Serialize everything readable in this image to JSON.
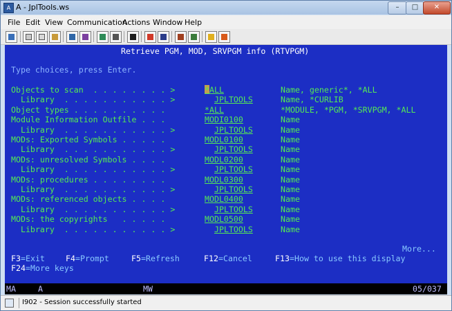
{
  "window": {
    "title": "A - JplTools.ws",
    "app_icon_label": "A"
  },
  "menu": [
    {
      "label": "File"
    },
    {
      "label": "Edit"
    },
    {
      "label": "View"
    },
    {
      "label": "Communication"
    },
    {
      "label": "Actions"
    },
    {
      "label": "Window"
    },
    {
      "label": "Help"
    }
  ],
  "screen": {
    "title": "Retrieve PGM, MOD, SRVPGM info (RTVPGM)",
    "instruction": "Type choices, press Enter.",
    "rows": [
      {
        "label": "Objects to scan  . . . . . . . . >",
        "value": "*ALL",
        "help": "Name, generic*, *ALL"
      },
      {
        "label": "  Library  . . . . . . . . . . . >",
        "value": "JPLTOOLS",
        "help": "Name, *CURLIB"
      },
      {
        "label": "Object types . . . . . . . . . . ",
        "value": "*ALL",
        "help": "*MODULE, *PGM, *SRVPGM, *ALL"
      },
      {
        "label": "Module Information Outfile . . . ",
        "value": "MODI0100",
        "help": "Name"
      },
      {
        "label": "  Library  . . . . . . . . . . . >",
        "value": "JPLTOOLS",
        "help": "Name"
      },
      {
        "label": "MODs: Exported Symbols . . . . . ",
        "value": "MODL0100",
        "help": "Name"
      },
      {
        "label": "  Library  . . . . . . . . . . . >",
        "value": "JPLTOOLS",
        "help": "Name"
      },
      {
        "label": "MODs: unresolved Symbols . . . . ",
        "value": "MODL0200",
        "help": "Name"
      },
      {
        "label": "  Library  . . . . . . . . . . . >",
        "value": "JPLTOOLS",
        "help": "Name"
      },
      {
        "label": "MODs: procedures . . . . . . . . ",
        "value": "MODL0300",
        "help": "Name"
      },
      {
        "label": "  Library  . . . . . . . . . . . >",
        "value": "JPLTOOLS",
        "help": "Name"
      },
      {
        "label": "MODs: referenced objects . . . . ",
        "value": "MODL0400",
        "help": "Name"
      },
      {
        "label": "  Library  . . . . . . . . . . . >",
        "value": "JPLTOOLS",
        "help": "Name"
      },
      {
        "label": "MODs: the copyrights   . . . . . ",
        "value": "MODL0500",
        "help": "Name"
      },
      {
        "label": "  Library  . . . . . . . . . . . >",
        "value": "JPLTOOLS",
        "help": "Name"
      }
    ],
    "more": "More...",
    "fkeys": [
      {
        "key": "F3",
        "label": "=Exit"
      },
      {
        "key": "F4",
        "label": "=Prompt"
      },
      {
        "key": "F5",
        "label": "=Refresh"
      },
      {
        "key": "F12",
        "label": "=Cancel"
      },
      {
        "key": "F13",
        "label": "=How to use this display"
      },
      {
        "key": "F24",
        "label": "=More keys"
      }
    ]
  },
  "oia": {
    "left1": "MA",
    "left2": "A",
    "mid": "MW",
    "cursor_pos": "05/037"
  },
  "status": {
    "message": "I902 - Session successfully started"
  },
  "colors": {
    "screen_bg": "#1c2ec4",
    "field_text": "#54ea54",
    "prompt_text": "#ffffff"
  }
}
